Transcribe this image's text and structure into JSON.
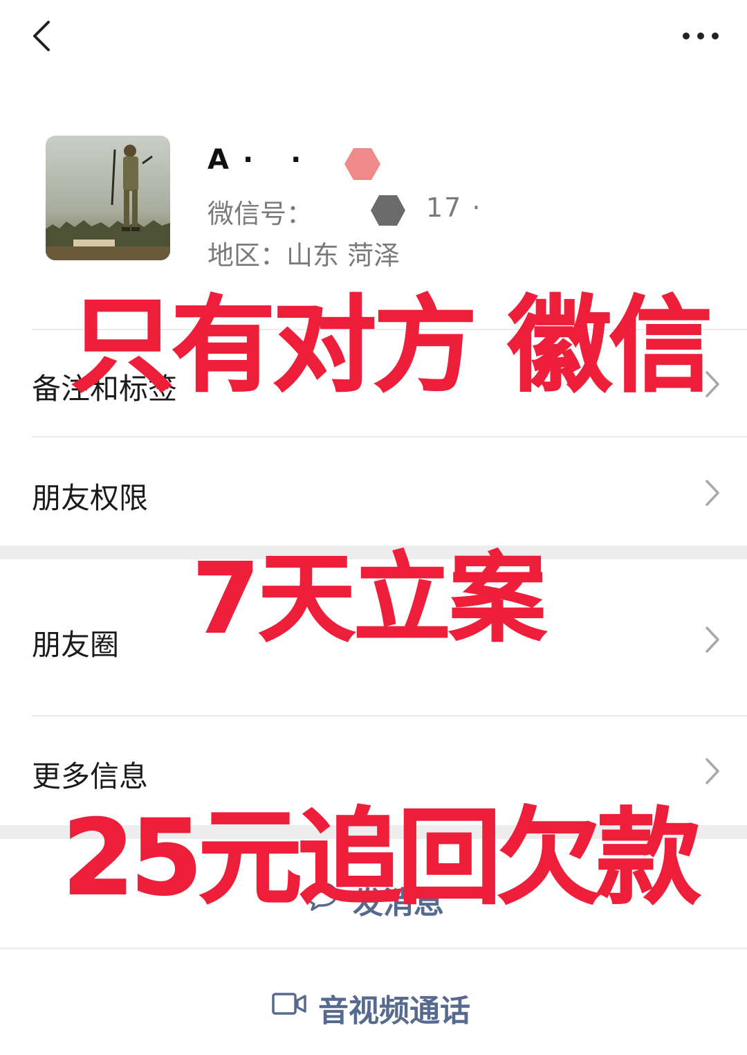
{
  "nav": {
    "back_icon": "chevron-left-icon",
    "more_icon": "more-dots-icon"
  },
  "profile": {
    "name": "A· ·",
    "wechat_id_label": "微信号：",
    "wechat_id_value": "17 ·",
    "region_label": "地区：",
    "region_value": "山东 菏泽"
  },
  "menu": [
    {
      "label": "备注和标签"
    },
    {
      "label": "朋友权限"
    },
    {
      "label": "朋友圈"
    },
    {
      "label": "更多信息"
    }
  ],
  "actions": {
    "message_label": "发消息",
    "call_label": "音视频通话"
  },
  "promo": {
    "line1": "只有对方 徽信",
    "line2": "7天立案",
    "line3": "25元追回欠款"
  },
  "colors": {
    "promo_red": "#ee1f3a",
    "action_blue": "#56698f",
    "divider": "#ececec"
  }
}
